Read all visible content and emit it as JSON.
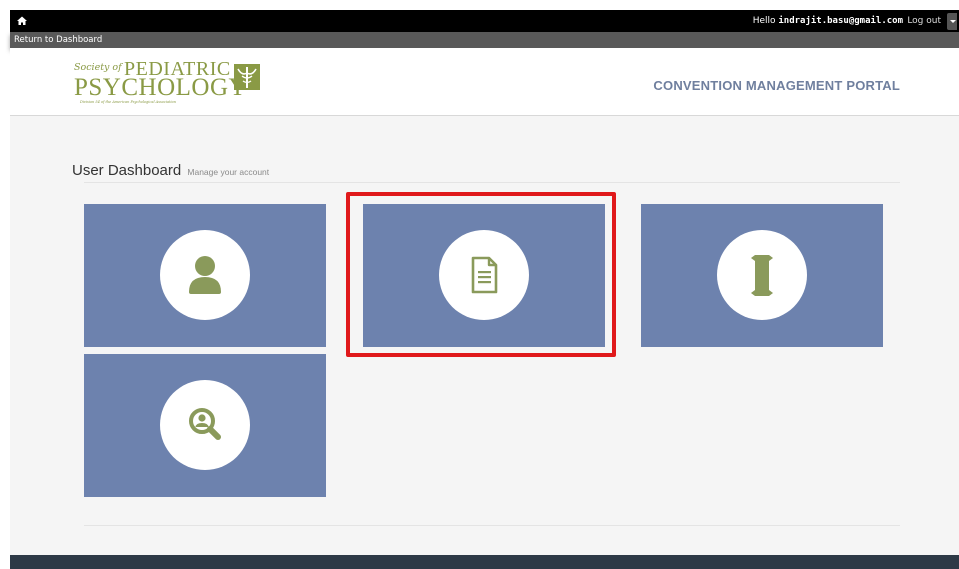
{
  "topbar": {
    "hello_prefix": "Hello",
    "user_email": "indrajit.basu@gmail.com",
    "logout_label": "Log out",
    "home_icon": "home-icon",
    "menu_caret_icon": "chevron-down-icon"
  },
  "returnbar": {
    "label": "Return to Dashboard"
  },
  "header": {
    "logo": {
      "society": "Society of",
      "pediatric": "PEDIATRIC",
      "psychology": "PSYCHOLOGY",
      "division": "Division 54 of the American Psychological Association"
    },
    "portal_title": "CONVENTION MANAGEMENT PORTAL"
  },
  "main": {
    "heading": "User Dashboard",
    "subheading": "Manage your account",
    "tiles": [
      {
        "icon": "user-icon"
      },
      {
        "icon": "document-icon",
        "highlighted": true
      },
      {
        "icon": "scroll-icon"
      },
      {
        "icon": "search-user-icon"
      }
    ]
  },
  "colors": {
    "tile_bg": "#6d82ae",
    "icon_green": "#8a9a5b",
    "highlight": "#e0191b",
    "portal_title": "#6f7f9e",
    "footer": "#2d3946"
  }
}
